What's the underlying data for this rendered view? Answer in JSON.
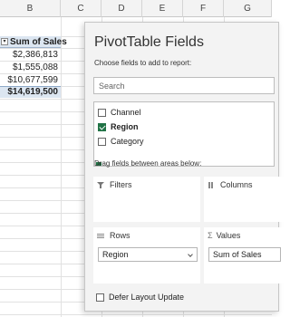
{
  "sheet": {
    "columns": [
      "B",
      "C",
      "D",
      "E",
      "F",
      "G"
    ],
    "pivot_header": "Sum of Sales",
    "pivot_values": [
      "$2,386,813",
      "$1,555,088",
      "$10,677,599"
    ],
    "pivot_total": "$14,619,500"
  },
  "pane": {
    "title": "PivotTable Fields",
    "subtitle": "Choose fields to add to report:",
    "search": {
      "placeholder": "Search",
      "value": ""
    },
    "fields": [
      {
        "label": "Channel",
        "checked": false
      },
      {
        "label": "Region",
        "checked": true
      },
      {
        "label": "Category",
        "checked": false
      }
    ],
    "drag_label": "Drag fields between areas below:",
    "areas": {
      "filters": {
        "label": "Filters",
        "icon": "filter-icon"
      },
      "columns": {
        "label": "Columns",
        "icon": "columns-icon"
      },
      "rows": {
        "label": "Rows",
        "icon": "rows-icon",
        "field": "Region"
      },
      "values": {
        "label": "Values",
        "icon": "sigma-icon",
        "field": "Sum of Sales"
      }
    },
    "defer_label": "Defer Layout Update",
    "accent_color": "#217346"
  }
}
